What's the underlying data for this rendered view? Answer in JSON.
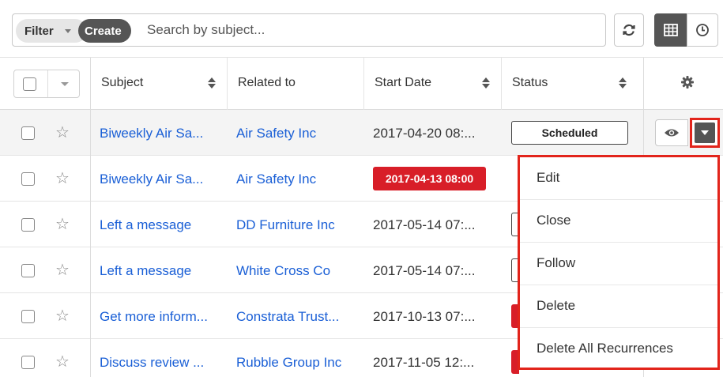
{
  "toolbar": {
    "filter_label": "Filter",
    "create_label": "Create",
    "search_placeholder": "Search by subject..."
  },
  "columns": {
    "subject": "Subject",
    "related_to": "Related to",
    "start_date": "Start Date",
    "status": "Status"
  },
  "rows": [
    {
      "subject": "Biweekly Air Sa...",
      "related": "Air Safety Inc",
      "date": "2017-04-20 08:...",
      "status": "Scheduled"
    },
    {
      "subject": "Biweekly Air Sa...",
      "related": "Air Safety Inc",
      "date": "2017-04-13 08:00",
      "status": ""
    },
    {
      "subject": "Left a message",
      "related": "DD Furniture Inc",
      "date": "2017-05-14 07:...",
      "status": ""
    },
    {
      "subject": "Left a message",
      "related": "White Cross Co",
      "date": "2017-05-14 07:...",
      "status": ""
    },
    {
      "subject": "Get more inform...",
      "related": "Constrata Trust...",
      "date": "2017-10-13 07:...",
      "status": ""
    },
    {
      "subject": "Discuss review ...",
      "related": "Rubble Group Inc",
      "date": "2017-11-05 12:...",
      "status": ""
    }
  ],
  "menu": {
    "items": [
      "Edit",
      "Close",
      "Follow",
      "Delete",
      "Delete All Recurrences"
    ]
  },
  "icons": {
    "refresh": "refresh-icon",
    "list_view": "list-view-icon",
    "activity_stream": "clock-icon",
    "settings": "gear-icon",
    "preview": "eye-icon",
    "favorite": "star-icon",
    "actions": "caret-down-icon"
  },
  "colors": {
    "accent_dark": "#555555",
    "link": "#1a5fd6",
    "overdue": "#d81e28",
    "highlight": "#e2241b"
  }
}
